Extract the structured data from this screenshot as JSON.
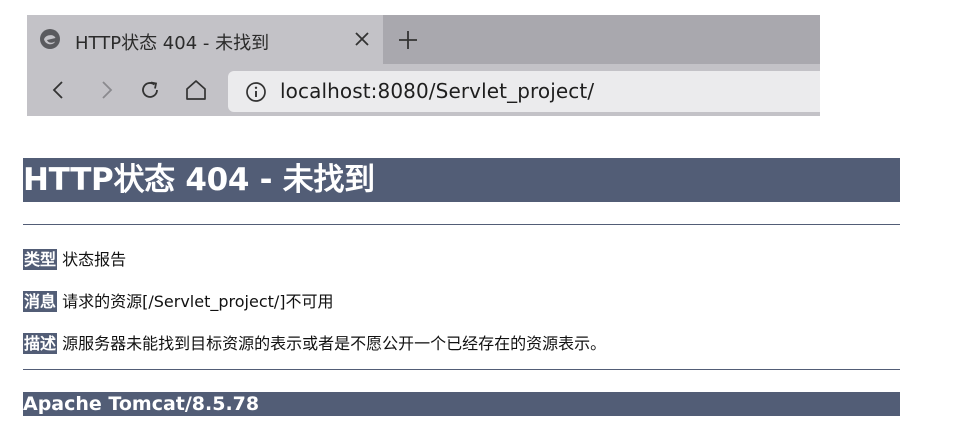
{
  "browser": {
    "tab": {
      "title": "HTTP状态 404 - 未找到",
      "favicon": "browser-logo-icon",
      "close_icon": "close-icon"
    },
    "new_tab_icon": "plus-icon",
    "nav": {
      "back_icon": "chevron-left-icon",
      "forward_icon": "chevron-right-icon",
      "reload_icon": "reload-icon",
      "home_icon": "home-icon"
    },
    "address": {
      "info_icon": "info-icon",
      "url": "localhost:8080/Servlet_project/"
    }
  },
  "page": {
    "title": "HTTP状态 404 - 未找到",
    "rows": [
      {
        "label": "类型",
        "value": "状态报告"
      },
      {
        "label": "消息",
        "value": "请求的资源[/Servlet_project/]不可用"
      },
      {
        "label": "描述",
        "value": "源服务器未能找到目标资源的表示或者是不愿公开一个已经存在的资源表示。"
      }
    ],
    "footer": "Apache Tomcat/8.5.78"
  },
  "colors": {
    "banner": "#525d76",
    "banner_text": "#ffffff",
    "tab_bg": "#c3c2c7",
    "tab_strip_bg": "#a9a8ae",
    "address_bg": "#ebebed"
  }
}
